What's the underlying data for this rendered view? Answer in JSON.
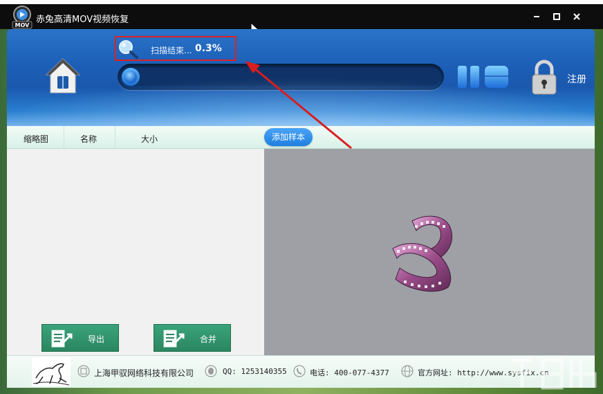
{
  "window": {
    "title": "赤兔高清MOV视频恢复",
    "logo_icon": "mov-logo-icon",
    "logo_text": "MOV",
    "controls": [
      "minimize",
      "maximize",
      "close"
    ]
  },
  "header": {
    "scan_status": "扫描结束...",
    "scan_percent": "0.3%",
    "progress": 0.003,
    "register_label": "注册",
    "highlight_color": "#e02020"
  },
  "columns": {
    "thumbnail": "缩略图",
    "name": "名称",
    "size": "大小",
    "add_sample": "添加样本"
  },
  "actions": {
    "export": "导出",
    "merge": "合并"
  },
  "footer": {
    "company": "上海甲驭网络科技有限公司",
    "qq": "QQ: 1253140355",
    "phone": "电话: 400-077-4377",
    "website": "官方网址: http://www.sysfix.cn"
  },
  "colors": {
    "header_blue": "#1d60b8",
    "button_green": "#2a8660",
    "accent_blue": "#1f7fe0",
    "preview_grey": "#9ea0a6"
  }
}
